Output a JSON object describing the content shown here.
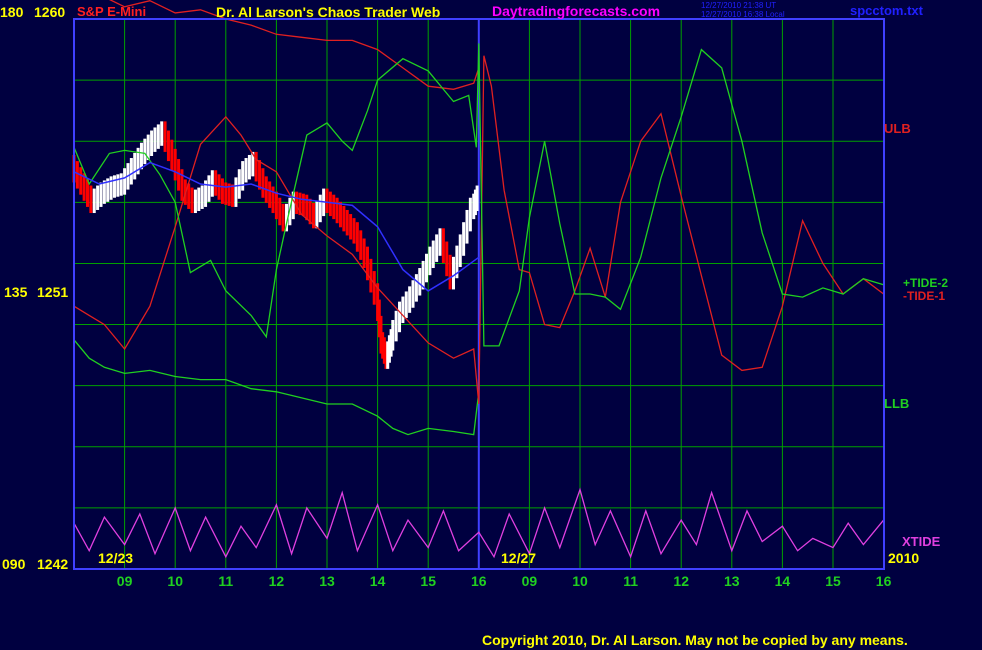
{
  "header": {
    "left_scale_label": "180",
    "left_price_label": "1260",
    "instrument": "S&P E-Mini",
    "title": "Dr. Al Larson's Chaos Trader Web",
    "site": "Daytradingforecasts.com",
    "timestamp_ut": "12/27/2010 21:38 UT",
    "timestamp_local": "12/27/2010 16:38 Local",
    "filename": "spcctom.txt"
  },
  "footer": {
    "copyright": "Copyright 2010, Dr. Al Larson. May not be copied by any means."
  },
  "colors": {
    "background": "#000040",
    "frame": "#4040ff",
    "grid": "#00a000",
    "title": "#ffff00",
    "instrument": "#ff2020",
    "site": "#ff00ff",
    "tide1": "#e02020",
    "tide2": "#20d020",
    "xtide": "#e040e0",
    "bars_up": "#ffffff",
    "bars_down": "#ff0000",
    "ma": "#3030ff",
    "date_labels": "#ffff00",
    "hour_labels": "#20d020"
  },
  "chart_data": {
    "type": "line",
    "left_axis": {
      "scale_ticks": [
        "180",
        "135",
        "090"
      ],
      "price_ticks": [
        "1260",
        "1251",
        "1242"
      ]
    },
    "x_hour_labels": [
      "09",
      "10",
      "11",
      "12",
      "13",
      "14",
      "15",
      "16",
      "09",
      "10",
      "11",
      "12",
      "13",
      "14",
      "15",
      "16"
    ],
    "date_labels": [
      "12/23",
      "12/27"
    ],
    "year_label": "2010",
    "right_labels": {
      "ulb": "ULB",
      "tide2": "+TIDE-2",
      "tide1": "-TIDE-1",
      "llb": "LLB",
      "xtide": "XTIDE"
    },
    "price_series": {
      "name": "S&P E-Mini 5-min bars",
      "hours": [
        8.0,
        8.2,
        8.4,
        8.6,
        8.8,
        9.0,
        9.2,
        9.4,
        9.6,
        9.8,
        10.0,
        10.2,
        10.4,
        10.6,
        10.8,
        11.0,
        11.2,
        11.4,
        11.6,
        11.8,
        12.0,
        12.2,
        12.4,
        12.6,
        12.8,
        13.0,
        13.2,
        13.4,
        13.6,
        13.8,
        14.0,
        14.1,
        14.2,
        14.3,
        14.5,
        14.7,
        14.9,
        15.1,
        15.3,
        15.5,
        15.7,
        15.9,
        16.0
      ],
      "close": [
        1255.2,
        1254.6,
        1254.0,
        1254.3,
        1254.5,
        1254.6,
        1255.1,
        1255.6,
        1256.0,
        1256.3,
        1255.4,
        1254.4,
        1254.0,
        1254.2,
        1254.7,
        1254.3,
        1254.2,
        1255.0,
        1255.3,
        1254.5,
        1254.0,
        1253.4,
        1254.0,
        1253.9,
        1253.5,
        1254.1,
        1253.8,
        1253.4,
        1253.0,
        1252.2,
        1251.0,
        1249.4,
        1248.9,
        1249.5,
        1250.4,
        1250.9,
        1251.5,
        1252.2,
        1252.8,
        1251.5,
        1252.6,
        1253.8,
        1254.2
      ]
    },
    "ma_series": {
      "name": "moving average",
      "hours": [
        8.0,
        8.5,
        9.0,
        9.5,
        10.0,
        10.5,
        11.0,
        11.5,
        12.0,
        12.5,
        13.0,
        13.5,
        14.0,
        14.5,
        15.0,
        15.5,
        16.0
      ],
      "values": [
        1255.0,
        1254.6,
        1254.8,
        1255.3,
        1255.0,
        1254.6,
        1254.5,
        1254.6,
        1254.3,
        1254.1,
        1254.0,
        1253.9,
        1253.2,
        1251.8,
        1251.1,
        1251.6,
        1252.2
      ]
    },
    "tide1": {
      "name": "-TIDE-1",
      "hours": [
        8.0,
        8.3,
        8.6,
        9.0,
        9.5,
        10.0,
        10.5,
        11.0,
        11.3,
        11.6,
        12.0,
        12.5,
        13.0,
        13.5,
        14.0,
        14.5,
        15.0,
        15.5,
        15.9,
        16.0,
        16.1,
        16.25,
        16.5,
        16.8,
        17.0,
        17.3,
        17.6,
        17.9,
        18.2,
        18.5,
        18.8,
        19.2,
        19.6,
        20.0,
        20.4,
        20.8,
        21.2,
        21.6,
        22.0,
        22.4,
        22.8,
        23.2,
        23.6,
        24.0
      ],
      "values": [
        1250.6,
        1250.3,
        1250.0,
        1249.2,
        1250.6,
        1253.2,
        1255.9,
        1256.8,
        1256.2,
        1255.4,
        1255.0,
        1253.6,
        1252.9,
        1252.3,
        1251.2,
        1250.3,
        1249.4,
        1248.9,
        1249.2,
        1247.4,
        1258.8,
        1257.8,
        1254.4,
        1251.8,
        1251.7,
        1250.0,
        1249.9,
        1251.1,
        1252.5,
        1250.9,
        1254.0,
        1256.0,
        1256.9,
        1254.2,
        1251.6,
        1249.0,
        1248.5,
        1248.6,
        1250.6,
        1253.4,
        1252.0,
        1251.0,
        1251.5,
        1251.0
      ]
    },
    "tide2": {
      "name": "+TIDE-2",
      "hours": [
        8.0,
        8.3,
        8.7,
        9.0,
        9.4,
        9.7,
        10.0,
        10.3,
        10.7,
        11.0,
        11.5,
        11.8,
        12.0,
        12.2,
        12.6,
        13.0,
        13.3,
        13.5,
        13.8,
        14.0,
        14.5,
        15.0,
        15.5,
        15.8,
        15.95,
        16.0,
        16.1,
        16.4,
        16.8,
        17.0,
        17.3,
        17.6,
        17.9,
        18.2,
        18.5,
        18.8,
        19.2,
        19.6,
        20.0,
        20.4,
        20.8,
        21.2,
        21.6,
        22.0,
        22.4,
        22.8,
        23.2,
        23.6,
        24.0
      ],
      "values": [
        1255.8,
        1254.6,
        1255.6,
        1255.7,
        1255.6,
        1254.9,
        1254.0,
        1251.7,
        1252.1,
        1251.1,
        1250.3,
        1249.6,
        1251.8,
        1253.3,
        1256.2,
        1256.6,
        1256.0,
        1255.7,
        1257.0,
        1258.0,
        1258.7,
        1258.3,
        1257.3,
        1257.5,
        1255.8,
        1259.2,
        1249.3,
        1249.3,
        1251.1,
        1253.5,
        1256.0,
        1253.3,
        1251.0,
        1251.0,
        1250.9,
        1250.5,
        1252.2,
        1254.8,
        1256.8,
        1259.0,
        1258.4,
        1256.0,
        1253.0,
        1251.0,
        1250.9,
        1251.2,
        1251.0,
        1251.5,
        1251.3
      ]
    },
    "ulb": {
      "name": "ULB",
      "hours": [
        8.0,
        8.5,
        9.0,
        9.5,
        10.0,
        10.5,
        11.0,
        11.5,
        12.0,
        12.5,
        13.0,
        13.5,
        14.0,
        14.5,
        15.0,
        15.5,
        15.9,
        16.0
      ],
      "values": [
        1261.2,
        1260.8,
        1260.4,
        1260.6,
        1260.2,
        1260.3,
        1260.0,
        1259.8,
        1259.5,
        1259.4,
        1259.3,
        1259.3,
        1259.0,
        1258.4,
        1257.8,
        1257.7,
        1257.9,
        1258.4
      ]
    },
    "llb": {
      "name": "LLB",
      "hours": [
        8.0,
        8.3,
        8.6,
        9.0,
        9.5,
        10.0,
        10.5,
        11.0,
        11.5,
        12.0,
        12.5,
        13.0,
        13.5,
        14.0,
        14.3,
        14.6,
        15.0,
        15.5,
        15.9,
        16.0
      ],
      "values": [
        1249.5,
        1248.9,
        1248.6,
        1248.4,
        1248.5,
        1248.3,
        1248.2,
        1248.2,
        1247.9,
        1247.8,
        1247.6,
        1247.4,
        1247.4,
        1247.0,
        1246.6,
        1246.4,
        1246.6,
        1246.5,
        1246.4,
        1247.8
      ]
    },
    "xtide": {
      "name": "XTIDE",
      "hours": [
        8.0,
        8.3,
        8.6,
        9.0,
        9.3,
        9.6,
        10.0,
        10.3,
        10.6,
        11.0,
        11.3,
        11.6,
        12.0,
        12.3,
        12.6,
        13.0,
        13.3,
        13.6,
        14.0,
        14.3,
        14.6,
        15.0,
        15.3,
        15.6,
        16.0,
        16.3,
        16.6,
        17.0,
        17.3,
        17.6,
        18.0,
        18.3,
        18.6,
        19.0,
        19.3,
        19.6,
        20.0,
        20.3,
        20.6,
        21.0,
        21.3,
        21.6,
        22.0,
        22.3,
        22.6,
        23.0,
        23.3,
        23.6,
        24.0
      ],
      "values": [
        1243.5,
        1242.6,
        1243.7,
        1242.8,
        1243.8,
        1242.5,
        1244.0,
        1242.6,
        1243.7,
        1242.4,
        1243.4,
        1242.7,
        1244.1,
        1242.5,
        1244.0,
        1243.0,
        1244.5,
        1242.6,
        1244.1,
        1242.6,
        1243.6,
        1242.7,
        1243.9,
        1242.6,
        1243.2,
        1242.4,
        1243.8,
        1242.5,
        1244.0,
        1242.7,
        1244.6,
        1242.8,
        1243.9,
        1242.4,
        1243.9,
        1242.5,
        1243.6,
        1242.8,
        1244.5,
        1242.6,
        1243.9,
        1242.9,
        1243.4,
        1242.6,
        1243.0,
        1242.7,
        1243.5,
        1242.8,
        1243.6
      ]
    }
  }
}
